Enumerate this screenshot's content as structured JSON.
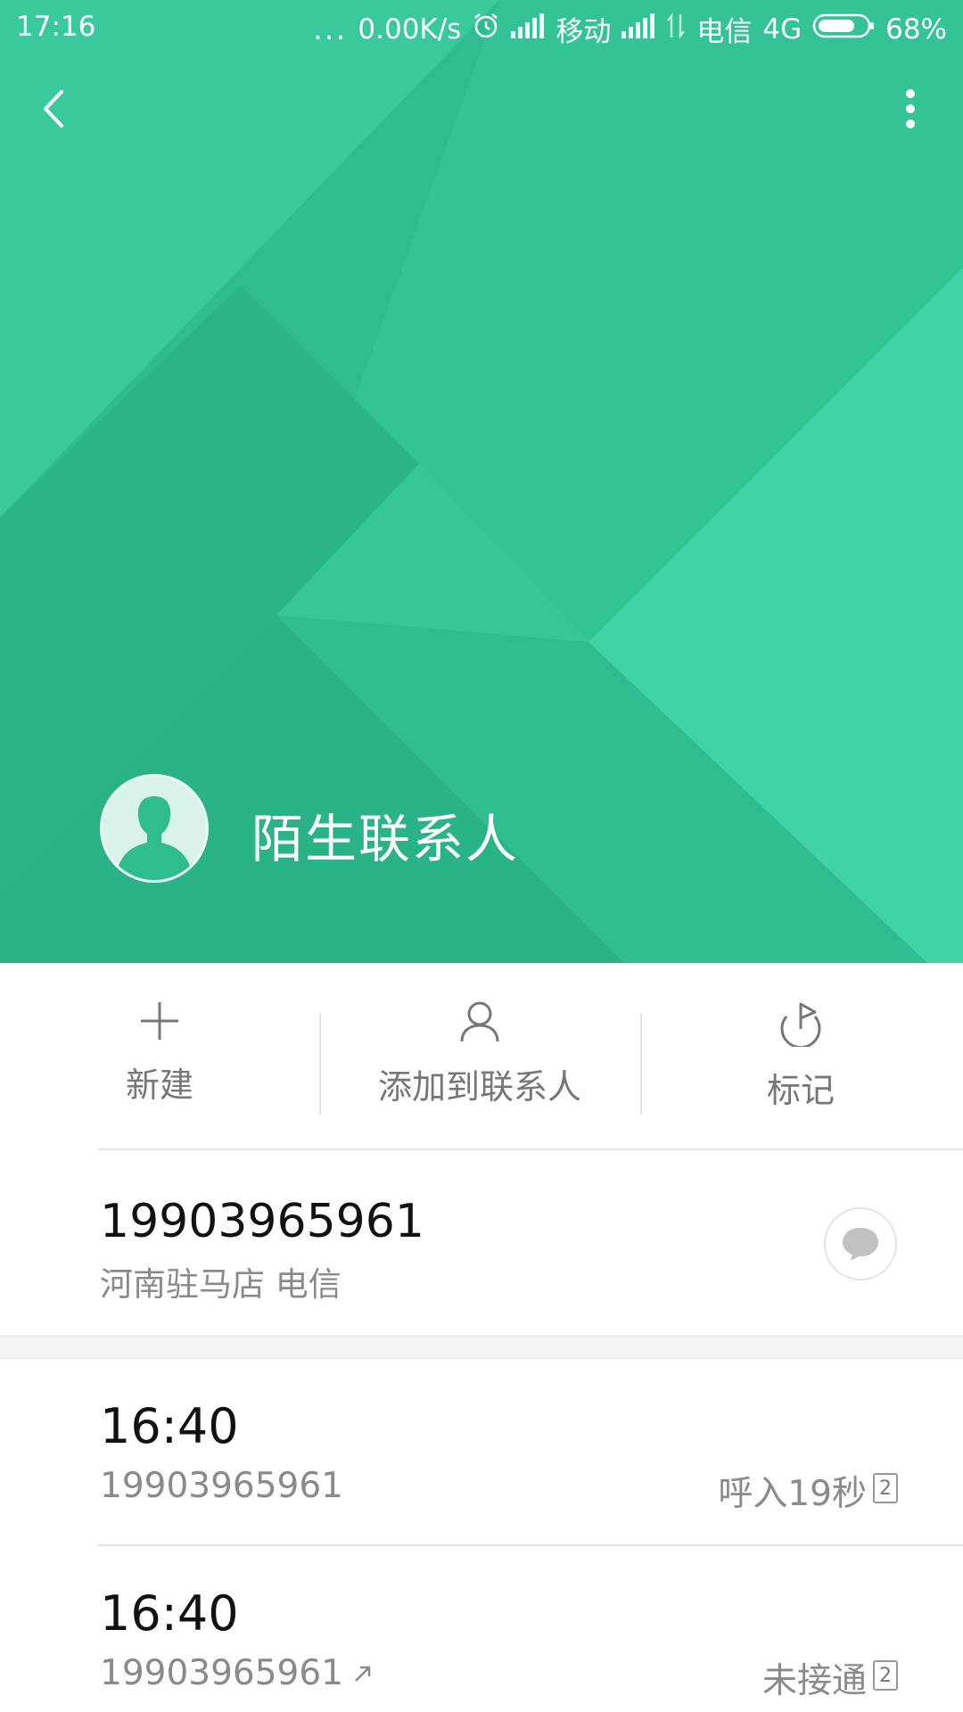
{
  "status_bar": {
    "time": "17:16",
    "more": "...",
    "speed": "0.00K/s",
    "carrier1": "移动",
    "carrier2": "电信",
    "network": "4G",
    "battery": "68%"
  },
  "header": {
    "contact_name": "陌生联系人"
  },
  "actions": [
    {
      "label": "新建",
      "icon": "plus-icon"
    },
    {
      "label": "添加到联系人",
      "icon": "person-icon"
    },
    {
      "label": "标记",
      "icon": "flag-icon"
    }
  ],
  "number_info": {
    "number": "19903965961",
    "location": "河南驻马店 电信"
  },
  "call_log": [
    {
      "time": "16:40",
      "number": "19903965961",
      "status": "呼入19秒",
      "sim": "2",
      "outgoing": false
    },
    {
      "time": "16:40",
      "number": "19903965961",
      "status": "未接通",
      "sim": "2",
      "outgoing": true
    }
  ],
  "colors": {
    "hero": "#2fbd8f",
    "hero_light": "#43d4a6",
    "text_dark": "#111111",
    "text_muted": "#8a8a8a"
  }
}
